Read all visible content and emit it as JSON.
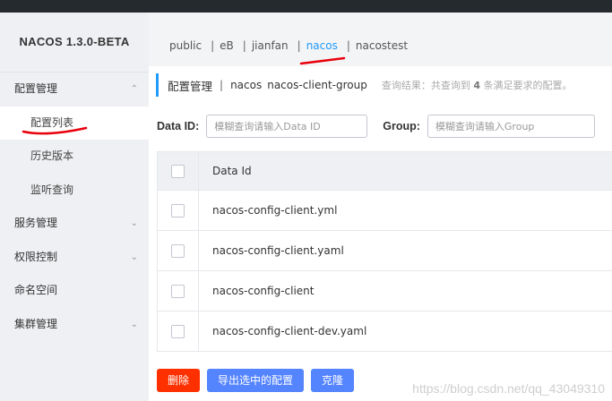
{
  "app": {
    "brand": "NACOS 1.3.0-BETA"
  },
  "sidebar": {
    "items": [
      {
        "label": "配置管理",
        "caret": "⌃"
      },
      {
        "label": "配置列表"
      },
      {
        "label": "历史版本"
      },
      {
        "label": "监听查询"
      },
      {
        "label": "服务管理",
        "caret": "⌄"
      },
      {
        "label": "权限控制",
        "caret": "⌄"
      },
      {
        "label": "命名空间"
      },
      {
        "label": "集群管理",
        "caret": "⌄"
      }
    ]
  },
  "namespaces": {
    "items": [
      "public",
      "eB",
      "jianfan",
      "nacos",
      "nacostest"
    ],
    "separator": "|",
    "active": "nacos"
  },
  "header": {
    "title": "配置管理",
    "separator": "|",
    "namespace": "nacos",
    "group": "nacos-client-group",
    "result_prefix": "查询结果：共查询到",
    "result_count": "4",
    "result_suffix": "条满足要求的配置。"
  },
  "search": {
    "dataid_label": "Data ID:",
    "dataid_placeholder": "模糊查询请输入Data ID",
    "group_label": "Group:",
    "group_placeholder": "模糊查询请输入Group"
  },
  "table": {
    "header": "Data Id",
    "rows": [
      "nacos-config-client.yml",
      "nacos-config-client.yaml",
      "nacos-config-client",
      "nacos-config-client-dev.yaml"
    ]
  },
  "actions": {
    "delete": "删除",
    "export": "导出选中的配置",
    "clone": "克隆"
  },
  "watermark": "https://blog.csdn.net/qq_43049310",
  "colors": {
    "accent": "#209bfa",
    "danger": "#ff3000",
    "primary": "#5584ff",
    "annotation": "#e8000b"
  }
}
